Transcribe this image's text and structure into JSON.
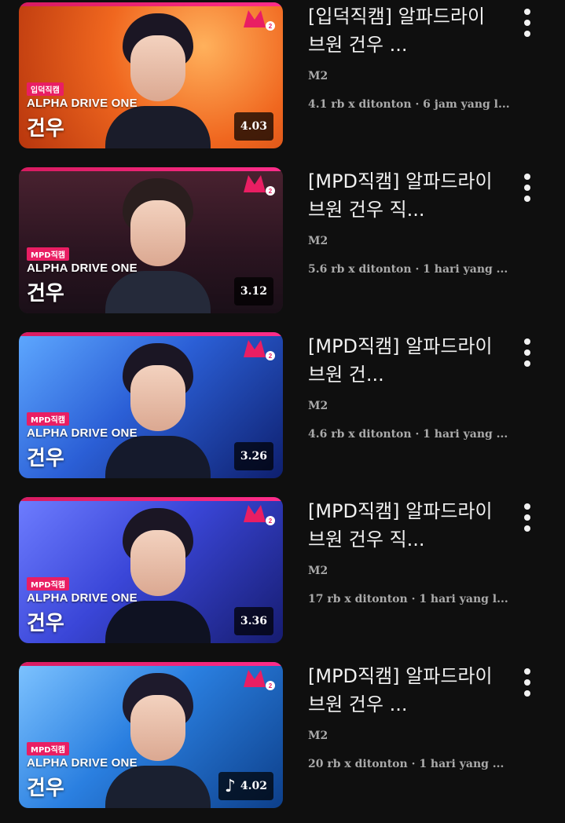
{
  "colors": {
    "background": "#0f0f0f",
    "title_text": "#f1f1f1",
    "meta_text": "#aaaaaa",
    "brand_pink": "#e91e63"
  },
  "videos": [
    {
      "title": "[입덕직캠] 알파드라이브원 건우 ...",
      "channel": "M2",
      "meta": "4.1 rb x ditonton · 6 jam yang l...",
      "duration": "4.03",
      "thumb_tag": "입덕직캠",
      "thumb_group": "ALPHA DRIVE ONE",
      "thumb_name": "건우",
      "theme": "#e8581c",
      "has_note_icon": false
    },
    {
      "title": "[MPD직캠] 알파드라이브원 건우 직...",
      "channel": "M2",
      "meta": "5.6 rb x ditonton · 1 hari yang ...",
      "duration": "3.12",
      "thumb_tag": "MPD직캠",
      "thumb_group": "ALPHA DRIVE ONE",
      "thumb_name": "건우",
      "theme": "#3a1c26",
      "has_note_icon": false
    },
    {
      "title": "[MPD직캠] 알파드라이브원 건...",
      "channel": "M2",
      "meta": "4.6 rb x ditonton · 1 hari yang ...",
      "duration": "3.26",
      "thumb_tag": "MPD직캠",
      "thumb_group": "ALPHA DRIVE ONE",
      "thumb_name": "건우",
      "theme": "#2b5fd6",
      "has_note_icon": false
    },
    {
      "title": "[MPD직캠] 알파드라이브원 건우 직...",
      "channel": "M2",
      "meta": "17 rb x ditonton · 1 hari yang l...",
      "duration": "3.36",
      "thumb_tag": "MPD직캠",
      "thumb_group": "ALPHA DRIVE ONE",
      "thumb_name": "건우",
      "theme": "#3a46d8",
      "has_note_icon": false
    },
    {
      "title": "[MPD직캠] 알파드라이브원 건우 ...",
      "channel": "M2",
      "meta": "20 rb x ditonton · 1 hari yang ...",
      "duration": "4.02",
      "thumb_tag": "MPD직캠",
      "thumb_group": "ALPHA DRIVE ONE",
      "thumb_name": "건우",
      "theme": "#2a7fe0",
      "has_note_icon": true
    }
  ],
  "icons": {
    "menu": "more-vertical-icon",
    "logo": "m2-logo-icon",
    "note": "music-note-icon"
  }
}
